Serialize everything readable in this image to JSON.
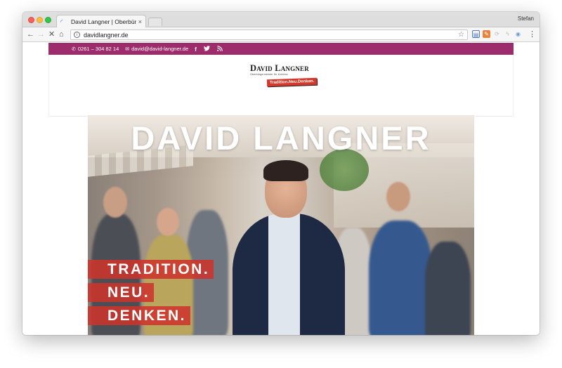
{
  "browser": {
    "tab_title": "David Langner | Oberbürgerme",
    "tab_close": "×",
    "profile_name": "Stefan",
    "url": "davidlangner.de",
    "nav": {
      "back": "←",
      "forward": "→",
      "stop": "✕",
      "home": "⌂"
    },
    "star": "☆",
    "menu": "⋮"
  },
  "topbar": {
    "phone": "0261 – 304 82 14",
    "email": "david@david-langner.de",
    "social": [
      "f",
      "twitter-icon",
      "rss-icon"
    ],
    "bg_color": "#9c2c6b"
  },
  "logo": {
    "name": "David Langner",
    "subtitle": "Oberbürgermeister für Koblenz",
    "slogan": "Tradition.Neu.Denken."
  },
  "hero": {
    "title": "DAVID LANGNER",
    "slogan_lines": [
      "TRADITION.",
      "NEU.",
      "DENKEN."
    ],
    "slogan_color": "#cd342c"
  }
}
